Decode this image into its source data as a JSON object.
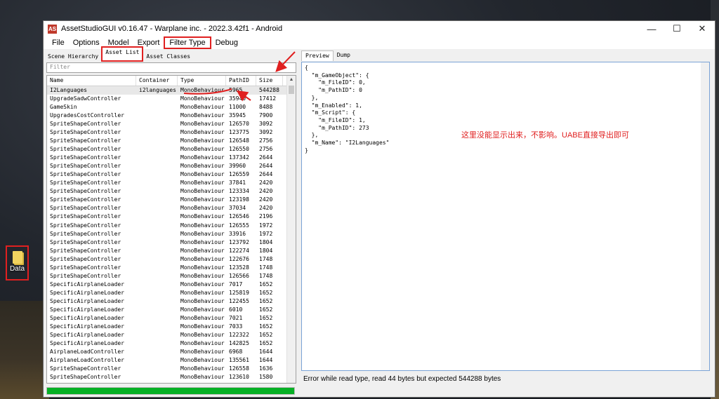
{
  "desktop": {
    "icon_label": "Data"
  },
  "window": {
    "title": "AssetStudioGUI v0.16.47 - Warplane inc. - 2022.3.42f1 - Android",
    "app_icon_text": "AS",
    "controls": {
      "minimize": "—",
      "maximize": "☐",
      "close": "✕"
    }
  },
  "menu": [
    "File",
    "Options",
    "Model",
    "Export",
    "Filter Type",
    "Debug"
  ],
  "left_tabs": [
    "Scene Hierarchy",
    "Asset List",
    "Asset Classes"
  ],
  "filter": {
    "placeholder": "Filter"
  },
  "columns": [
    "Name",
    "Container",
    "Type",
    "PathID",
    "Size"
  ],
  "rows": [
    [
      "I2Languages",
      "i2languages",
      "MonoBehaviour",
      "5965",
      "544288"
    ],
    [
      "UpgradeSadwController",
      "",
      "MonoBehaviour",
      "35940",
      "17412"
    ],
    [
      "GameSkin",
      "",
      "MonoBehaviour",
      "11000",
      "8488"
    ],
    [
      "UpgradesCostController",
      "",
      "MonoBehaviour",
      "35945",
      "7900"
    ],
    [
      "SpriteShapeController",
      "",
      "MonoBehaviour",
      "126570",
      "3092"
    ],
    [
      "SpriteShapeController",
      "",
      "MonoBehaviour",
      "123775",
      "3092"
    ],
    [
      "SpriteShapeController",
      "",
      "MonoBehaviour",
      "126548",
      "2756"
    ],
    [
      "SpriteShapeController",
      "",
      "MonoBehaviour",
      "126550",
      "2756"
    ],
    [
      "SpriteShapeController",
      "",
      "MonoBehaviour",
      "137342",
      "2644"
    ],
    [
      "SpriteShapeController",
      "",
      "MonoBehaviour",
      "39960",
      "2644"
    ],
    [
      "SpriteShapeController",
      "",
      "MonoBehaviour",
      "126559",
      "2644"
    ],
    [
      "SpriteShapeController",
      "",
      "MonoBehaviour",
      "37841",
      "2420"
    ],
    [
      "SpriteShapeController",
      "",
      "MonoBehaviour",
      "123334",
      "2420"
    ],
    [
      "SpriteShapeController",
      "",
      "MonoBehaviour",
      "123198",
      "2420"
    ],
    [
      "SpriteShapeController",
      "",
      "MonoBehaviour",
      "37034",
      "2420"
    ],
    [
      "SpriteShapeController",
      "",
      "MonoBehaviour",
      "126546",
      "2196"
    ],
    [
      "SpriteShapeController",
      "",
      "MonoBehaviour",
      "126555",
      "1972"
    ],
    [
      "SpriteShapeController",
      "",
      "MonoBehaviour",
      "33916",
      "1972"
    ],
    [
      "SpriteShapeController",
      "",
      "MonoBehaviour",
      "123792",
      "1804"
    ],
    [
      "SpriteShapeController",
      "",
      "MonoBehaviour",
      "122274",
      "1804"
    ],
    [
      "SpriteShapeController",
      "",
      "MonoBehaviour",
      "122676",
      "1748"
    ],
    [
      "SpriteShapeController",
      "",
      "MonoBehaviour",
      "123528",
      "1748"
    ],
    [
      "SpriteShapeController",
      "",
      "MonoBehaviour",
      "126566",
      "1748"
    ],
    [
      "SpecificAirplaneLoader",
      "",
      "MonoBehaviour",
      "7017",
      "1652"
    ],
    [
      "SpecificAirplaneLoader",
      "",
      "MonoBehaviour",
      "125819",
      "1652"
    ],
    [
      "SpecificAirplaneLoader",
      "",
      "MonoBehaviour",
      "122455",
      "1652"
    ],
    [
      "SpecificAirplaneLoader",
      "",
      "MonoBehaviour",
      "6010",
      "1652"
    ],
    [
      "SpecificAirplaneLoader",
      "",
      "MonoBehaviour",
      "7021",
      "1652"
    ],
    [
      "SpecificAirplaneLoader",
      "",
      "MonoBehaviour",
      "7033",
      "1652"
    ],
    [
      "SpecificAirplaneLoader",
      "",
      "MonoBehaviour",
      "122322",
      "1652"
    ],
    [
      "SpecificAirplaneLoader",
      "",
      "MonoBehaviour",
      "142825",
      "1652"
    ],
    [
      "AirplaneLoadController",
      "",
      "MonoBehaviour",
      "6968",
      "1644"
    ],
    [
      "AirplaneLoadController",
      "",
      "MonoBehaviour",
      "135561",
      "1644"
    ],
    [
      "SpriteShapeController",
      "",
      "MonoBehaviour",
      "126558",
      "1636"
    ],
    [
      "SpriteShapeController",
      "",
      "MonoBehaviour",
      "123610",
      "1580"
    ]
  ],
  "progress": {
    "fraction": 1.0,
    "color": "#06b025"
  },
  "right_tabs": [
    "Preview",
    "Dump"
  ],
  "preview_json": "{\n  \"m_GameObject\": {\n    \"m_FileID\": 0,\n    \"m_PathID\": 0\n  },\n  \"m_Enabled\": 1,\n  \"m_Script\": {\n    \"m_FileID\": 1,\n    \"m_PathID\": 273\n  },\n  \"m_Name\": \"I2Languages\"\n}",
  "annotation": "这里没能显示出来，不影响。UABE直接导出即可",
  "status": "Error while read type, read 44 bytes but expected 544288 bytes",
  "colors": {
    "highlight": "#e02020",
    "selected_row": "#e8e8e8",
    "json_border": "#7aa3d6"
  }
}
